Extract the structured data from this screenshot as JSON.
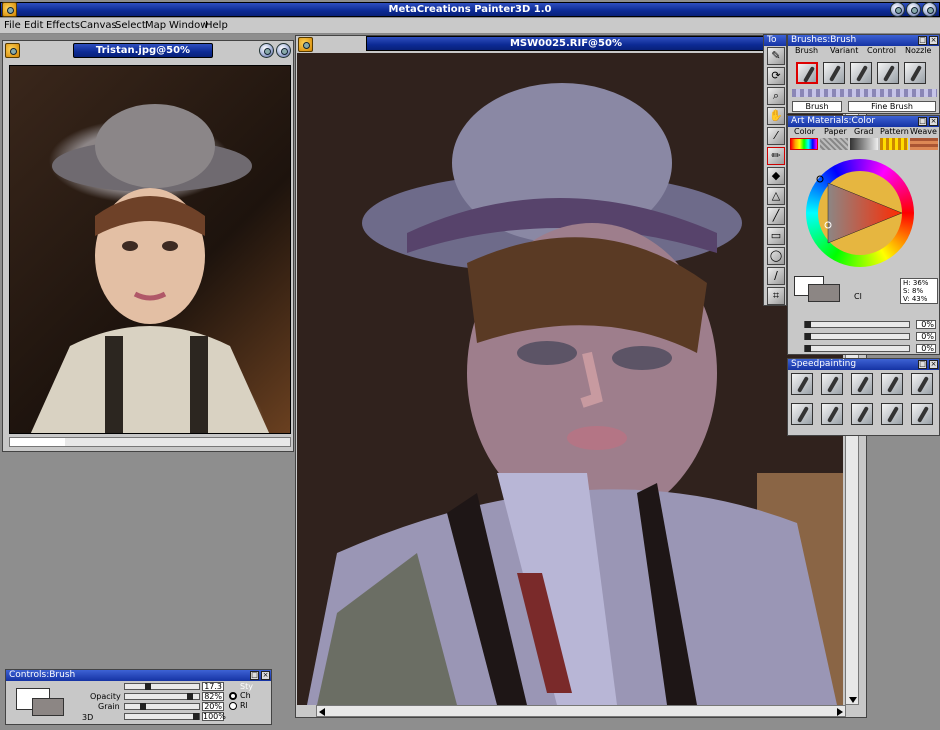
{
  "app": {
    "title": "MetaCreations Painter3D 1.0"
  },
  "menu": [
    "File",
    "Edit",
    "Effects",
    "Canvas",
    "Select",
    "Map",
    "Window",
    "Help"
  ],
  "reference_window": {
    "title": "Tristan.jpg@50%"
  },
  "main_window": {
    "title": "MSW0025.RIF@50%"
  },
  "tools_palette": {
    "title": "To"
  },
  "brushes_palette": {
    "title": "Brushes:Brush",
    "tabs": [
      "Brush",
      "Variant",
      "Control",
      "Nozzle"
    ],
    "brush_name": "Brush",
    "variant_name": "Fine Brush"
  },
  "art_materials": {
    "title": "Art Materials:Color",
    "tabs": [
      "Color",
      "Paper",
      "Grad",
      "Pattern",
      "Weave"
    ],
    "hsv": {
      "h_label": "H:",
      "h": "36%",
      "s_label": "S:",
      "s": "8%",
      "v_label": "V:",
      "v": "43%"
    },
    "clone_label": "Cl",
    "sliders": [
      "0%",
      "0%",
      "0%"
    ],
    "primary_color": "#ffffff",
    "secondary_color": "#8c8684"
  },
  "speedpainting": {
    "title": "Speedpainting"
  },
  "controls_palette": {
    "title": "Controls:Brush",
    "rows": [
      {
        "label": "",
        "value": "17.3"
      },
      {
        "label": "Opacity",
        "value": "82%"
      },
      {
        "label": "Grain",
        "value": "20%"
      },
      {
        "label": "3D",
        "value": "100%"
      }
    ],
    "radio1": "Sty",
    "radio2": "Ch",
    "radio3": "Rl"
  },
  "colors": {
    "titlebar": "#0c2a94",
    "menu_bg": "#c9c9c9",
    "desktop": "#8e8e8e",
    "canvas_bg": "#30221d"
  }
}
